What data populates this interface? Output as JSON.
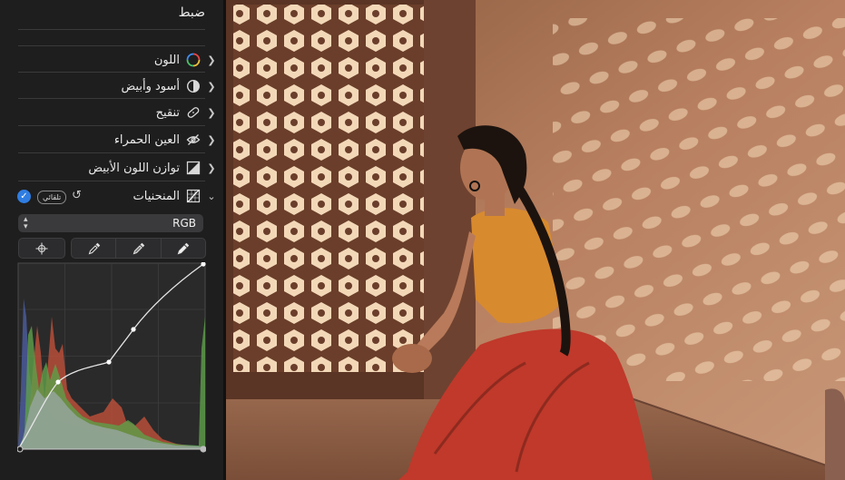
{
  "panel": {
    "title": "ضبط",
    "sections": [
      {
        "label": "اللون",
        "icon": "color-wheel-icon"
      },
      {
        "label": "أسود وأبيض",
        "icon": "half-circle-icon"
      },
      {
        "label": "تنقيح",
        "icon": "bandage-icon"
      },
      {
        "label": "العين الحمراء",
        "icon": "red-eye-icon"
      },
      {
        "label": "توازن اللون الأبيض",
        "icon": "white-balance-icon"
      }
    ],
    "curves": {
      "label": "المنحنيات",
      "icon": "curves-icon",
      "auto_label": "تلقائي",
      "channel": "RGB"
    }
  },
  "colors": {
    "accent": "#2f7de1",
    "panel_bg": "#1e1e1e",
    "divider": "#3a3a3a"
  }
}
